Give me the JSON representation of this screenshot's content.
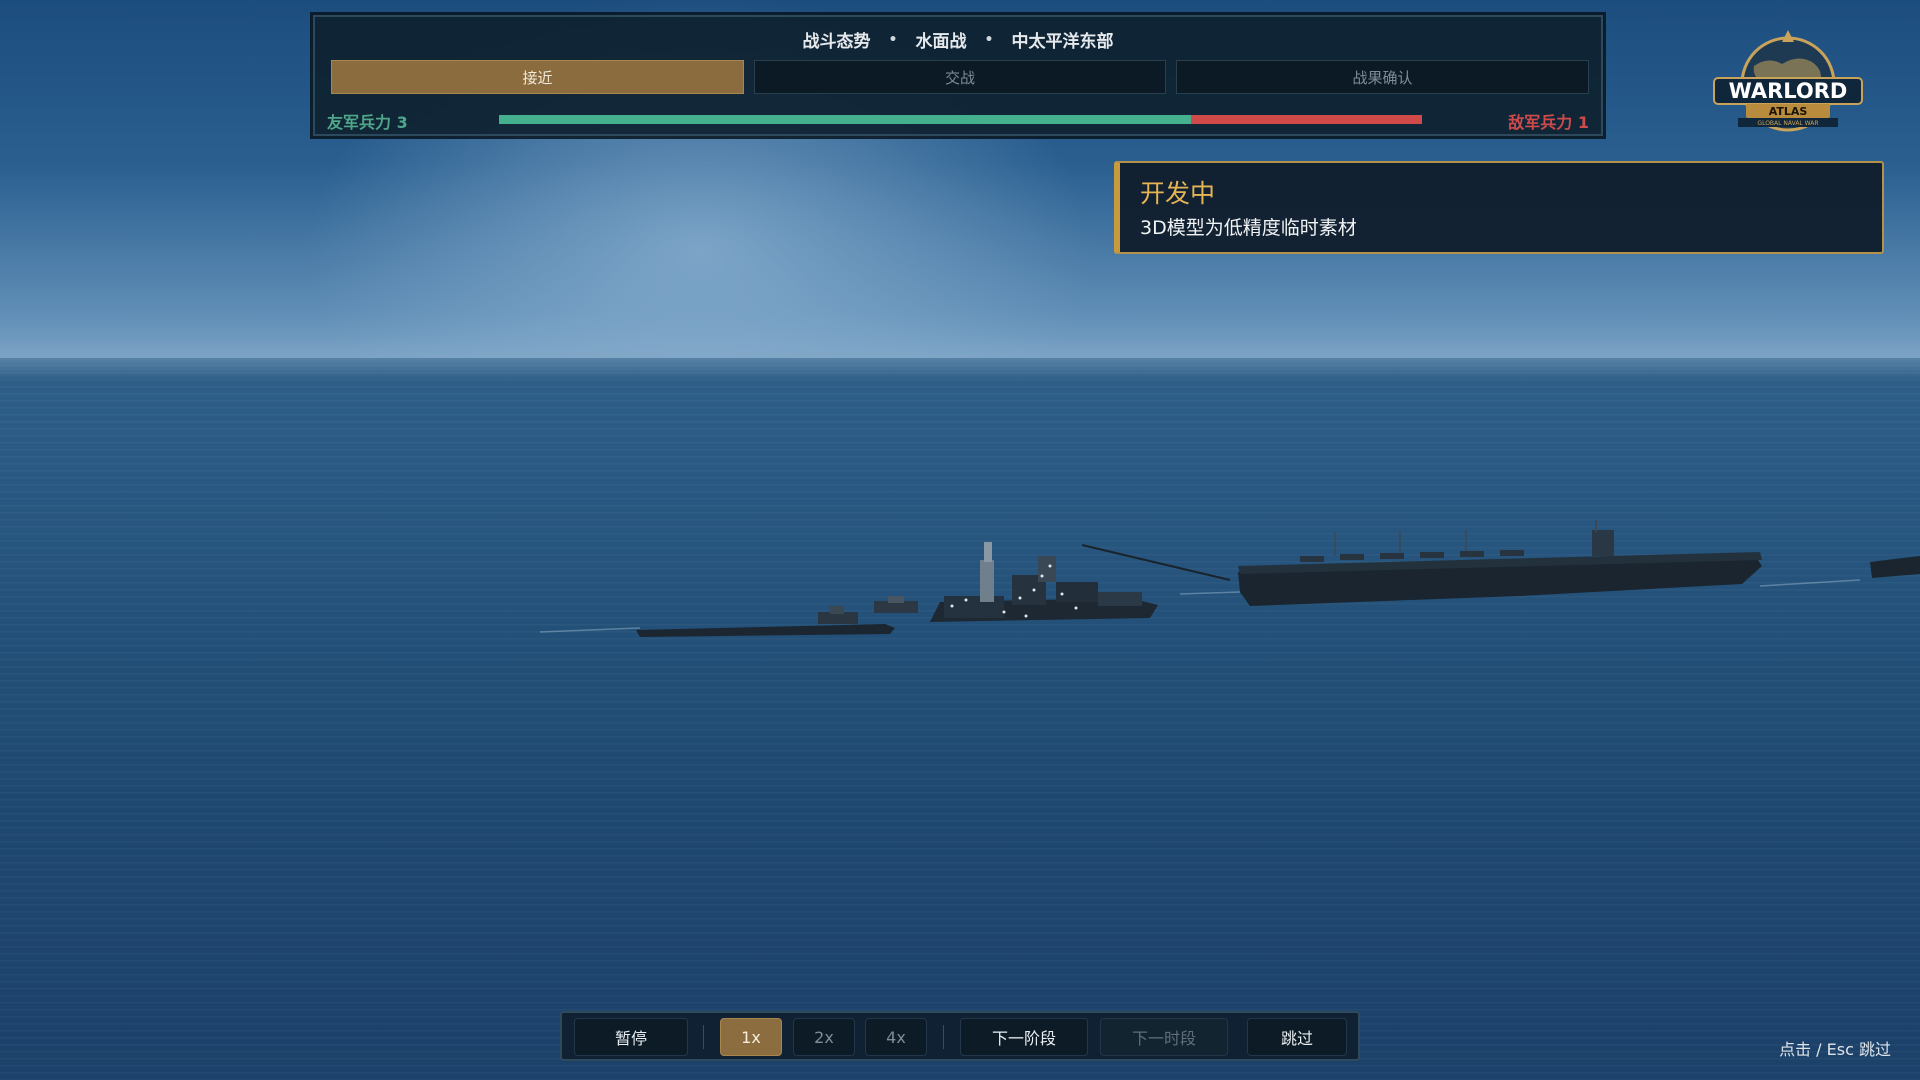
{
  "header": {
    "title_parts": [
      "战斗态势",
      "水面战",
      "中太平洋东部"
    ],
    "separator": "•"
  },
  "phases": [
    {
      "label": "接近",
      "active": true
    },
    {
      "label": "交战",
      "active": false
    },
    {
      "label": "战果确认",
      "active": false
    }
  ],
  "forces": {
    "friendly_label": "友军兵力 3",
    "enemy_label": "敌军兵力 1",
    "friendly_count": 3,
    "enemy_count": 1,
    "friendly_color": "#44b08e",
    "enemy_color": "#d14a4a"
  },
  "logo": {
    "line1": "WARLORD",
    "line2": "ATLAS",
    "line3": "GLOBAL NAVAL WAR"
  },
  "notice": {
    "title": "开发中",
    "body": "3D模型为低精度临时素材"
  },
  "controls": {
    "pause_label": "暂停",
    "speeds": [
      "1x",
      "2x",
      "4x"
    ],
    "active_speed": "1x",
    "next_phase_label": "下一阶段",
    "next_time_label": "下一时段",
    "skip_label": "跳过"
  },
  "skip_hint": "点击 / Esc 跳过",
  "colors": {
    "accent_gold": "#8a6c3e",
    "notice_title": "#e6b454"
  }
}
